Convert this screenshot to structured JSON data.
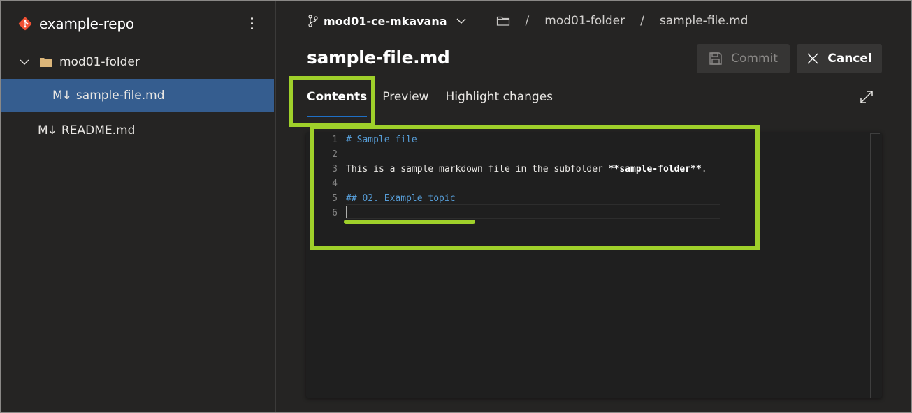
{
  "sidebar": {
    "repo_icon": "git-repo-icon",
    "repo_name": "example-repo",
    "more_icon": "more-vertical-icon",
    "tree": [
      {
        "type": "folder",
        "label": "mod01-folder",
        "expanded": true,
        "icon": "folder-icon",
        "chevron": "chevron-down-icon"
      },
      {
        "type": "file",
        "label": "sample-file.md",
        "icon_text": "M↓",
        "selected": true
      },
      {
        "type": "file",
        "label": "README.md",
        "icon_text": "M↓",
        "selected": false
      }
    ]
  },
  "topbar": {
    "branch_icon": "branch-icon",
    "branch": "mod01-ce-mkavana",
    "breadcrumb_sep": "/",
    "breadcrumb": [
      "mod01-folder",
      "sample-file.md"
    ]
  },
  "file_title": "sample-file.md",
  "buttons": {
    "commit": {
      "label": "Commit",
      "icon": "save-icon",
      "enabled": false
    },
    "cancel": {
      "label": "Cancel",
      "icon": "close-icon"
    }
  },
  "tabs": [
    {
      "label": "Contents",
      "active": true
    },
    {
      "label": "Preview",
      "active": false
    },
    {
      "label": "Highlight changes",
      "active": false
    }
  ],
  "expand_icon": "expand-icon",
  "editor": {
    "lines": [
      {
        "n": "1",
        "text": "# Sample file",
        "kind": "heading"
      },
      {
        "n": "2",
        "text": "",
        "kind": "text"
      },
      {
        "n": "3",
        "text": "This is a sample markdown file in the subfolder ",
        "bold": "**sample-folder**",
        "after": ".",
        "kind": "text"
      },
      {
        "n": "4",
        "text": "",
        "kind": "text"
      },
      {
        "n": "5",
        "text": "## 02. Example topic",
        "kind": "heading"
      },
      {
        "n": "6",
        "text": "",
        "kind": "text"
      }
    ],
    "cursor_line": 6
  },
  "colors": {
    "highlight": "#9fd02a",
    "selected_item": "#355d8f",
    "tab_underline": "#1f6fc5",
    "md_heading": "#569cd6",
    "git_icon": "#f05033",
    "folder": "#dcb67a"
  }
}
